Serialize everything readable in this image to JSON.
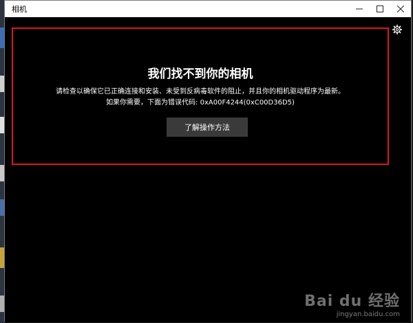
{
  "window": {
    "title": "相机"
  },
  "error": {
    "heading": "我们找不到你的相机",
    "line1": "请检查以确保它已正确连接和安装、未受到反病毒软件的阻止，并且你的相机驱动程序为最新。",
    "line2": "如果你需要，下面为错误代码: 0xA00F4244(0xC00D36D5)",
    "button_label": "了解操作方法"
  },
  "colors": {
    "highlight_border": "#e3161c",
    "background": "#000000",
    "button_bg": "#3a3a3a"
  },
  "icons": {
    "settings": "gear-icon",
    "minimize": "minimize-icon",
    "maximize": "maximize-icon",
    "close": "close-icon"
  },
  "watermark": {
    "logo": "Bai du 经验",
    "url": "jingyan.baidu.com"
  }
}
